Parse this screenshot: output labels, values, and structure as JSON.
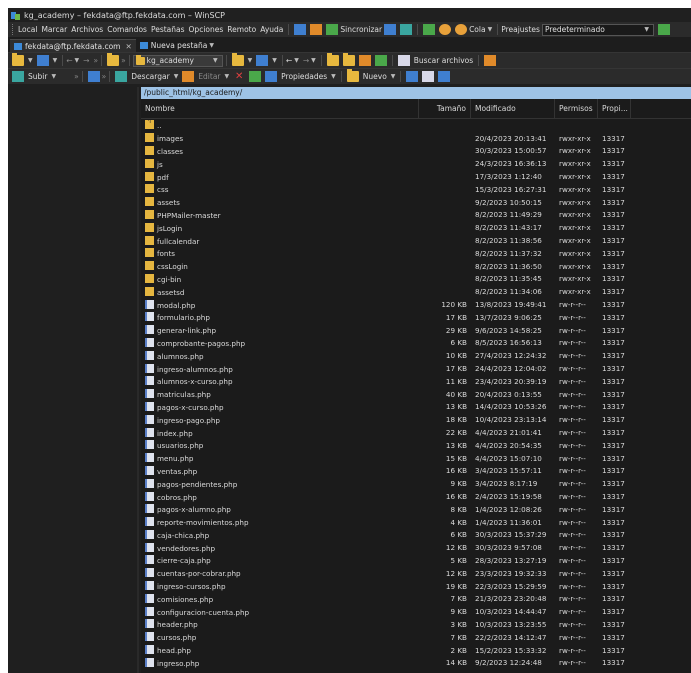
{
  "window": {
    "title": "kg_academy – fekdata@ftp.fekdata.com – WinSCP"
  },
  "menubar": {
    "items": [
      "Local",
      "Marcar",
      "Archivos",
      "Comandos",
      "Pestañas",
      "Opciones",
      "Remoto",
      "Ayuda"
    ],
    "sync_label": "Sincronizar",
    "queue_label": "Cola",
    "presets_label": "Preajustes",
    "preset_value": "Predeterminado"
  },
  "tabs": [
    {
      "label": "fekdata@ftp.fekdata.com"
    },
    {
      "label": "Nueva pestaña"
    }
  ],
  "left_toolbar": {
    "upload_label": "Subir"
  },
  "remote_toolbar": {
    "directory": "kg_academy",
    "find_label": "Buscar archivos",
    "download_label": "Descargar",
    "edit_label": "Editar",
    "properties_label": "Propiedades",
    "new_label": "Nuevo"
  },
  "remote_path": "/public_html/kg_academy/",
  "columns": {
    "name": "Nombre",
    "size": "Tamaño",
    "modified": "Modificado",
    "perms": "Permisos",
    "owner": "Propi..."
  },
  "files": [
    {
      "name": "..",
      "size": "",
      "modified": "",
      "perms": "",
      "owner": "",
      "type": "updir"
    },
    {
      "name": "images",
      "size": "",
      "modified": "20/4/2023 20:13:41",
      "perms": "rwxr-xr-x",
      "owner": "13317",
      "type": "dir"
    },
    {
      "name": "classes",
      "size": "",
      "modified": "30/3/2023 15:00:57",
      "perms": "rwxr-xr-x",
      "owner": "13317",
      "type": "dir"
    },
    {
      "name": "js",
      "size": "",
      "modified": "24/3/2023 16:36:13",
      "perms": "rwxr-xr-x",
      "owner": "13317",
      "type": "dir"
    },
    {
      "name": "pdf",
      "size": "",
      "modified": "17/3/2023 1:12:40",
      "perms": "rwxr-xr-x",
      "owner": "13317",
      "type": "dir"
    },
    {
      "name": "css",
      "size": "",
      "modified": "15/3/2023 16:27:31",
      "perms": "rwxr-xr-x",
      "owner": "13317",
      "type": "dir"
    },
    {
      "name": "assets",
      "size": "",
      "modified": "9/2/2023 10:50:15",
      "perms": "rwxr-xr-x",
      "owner": "13317",
      "type": "dir"
    },
    {
      "name": "PHPMailer-master",
      "size": "",
      "modified": "8/2/2023 11:49:29",
      "perms": "rwxr-xr-x",
      "owner": "13317",
      "type": "dir"
    },
    {
      "name": "jsLogin",
      "size": "",
      "modified": "8/2/2023 11:43:17",
      "perms": "rwxr-xr-x",
      "owner": "13317",
      "type": "dir"
    },
    {
      "name": "fullcalendar",
      "size": "",
      "modified": "8/2/2023 11:38:56",
      "perms": "rwxr-xr-x",
      "owner": "13317",
      "type": "dir"
    },
    {
      "name": "fonts",
      "size": "",
      "modified": "8/2/2023 11:37:32",
      "perms": "rwxr-xr-x",
      "owner": "13317",
      "type": "dir"
    },
    {
      "name": "cssLogin",
      "size": "",
      "modified": "8/2/2023 11:36:50",
      "perms": "rwxr-xr-x",
      "owner": "13317",
      "type": "dir"
    },
    {
      "name": "cgi-bin",
      "size": "",
      "modified": "8/2/2023 11:35:45",
      "perms": "rwxr-xr-x",
      "owner": "13317",
      "type": "dir"
    },
    {
      "name": "assetsd",
      "size": "",
      "modified": "8/2/2023 11:34:06",
      "perms": "rwxr-xr-x",
      "owner": "13317",
      "type": "dir"
    },
    {
      "name": "modal.php",
      "size": "120 KB",
      "modified": "13/8/2023 19:49:41",
      "perms": "rw-r--r--",
      "owner": "13317",
      "type": "file"
    },
    {
      "name": "formulario.php",
      "size": "17 KB",
      "modified": "13/7/2023 9:06:25",
      "perms": "rw-r--r--",
      "owner": "13317",
      "type": "file"
    },
    {
      "name": "generar-link.php",
      "size": "29 KB",
      "modified": "9/6/2023 14:58:25",
      "perms": "rw-r--r--",
      "owner": "13317",
      "type": "file"
    },
    {
      "name": "comprobante-pagos.php",
      "size": "6 KB",
      "modified": "8/5/2023 16:56:13",
      "perms": "rw-r--r--",
      "owner": "13317",
      "type": "file"
    },
    {
      "name": "alumnos.php",
      "size": "10 KB",
      "modified": "27/4/2023 12:24:32",
      "perms": "rw-r--r--",
      "owner": "13317",
      "type": "file"
    },
    {
      "name": "ingreso-alumnos.php",
      "size": "17 KB",
      "modified": "24/4/2023 12:04:02",
      "perms": "rw-r--r--",
      "owner": "13317",
      "type": "file"
    },
    {
      "name": "alumnos-x-curso.php",
      "size": "11 KB",
      "modified": "23/4/2023 20:39:19",
      "perms": "rw-r--r--",
      "owner": "13317",
      "type": "file"
    },
    {
      "name": "matriculas.php",
      "size": "40 KB",
      "modified": "20/4/2023 0:13:55",
      "perms": "rw-r--r--",
      "owner": "13317",
      "type": "file"
    },
    {
      "name": "pagos-x-curso.php",
      "size": "13 KB",
      "modified": "14/4/2023 10:53:26",
      "perms": "rw-r--r--",
      "owner": "13317",
      "type": "file"
    },
    {
      "name": "ingreso-pago.php",
      "size": "18 KB",
      "modified": "10/4/2023 23:13:14",
      "perms": "rw-r--r--",
      "owner": "13317",
      "type": "file"
    },
    {
      "name": "index.php",
      "size": "22 KB",
      "modified": "4/4/2023 21:01:41",
      "perms": "rw-r--r--",
      "owner": "13317",
      "type": "file"
    },
    {
      "name": "usuarios.php",
      "size": "13 KB",
      "modified": "4/4/2023 20:54:35",
      "perms": "rw-r--r--",
      "owner": "13317",
      "type": "file"
    },
    {
      "name": "menu.php",
      "size": "15 KB",
      "modified": "4/4/2023 15:07:10",
      "perms": "rw-r--r--",
      "owner": "13317",
      "type": "file"
    },
    {
      "name": "ventas.php",
      "size": "16 KB",
      "modified": "3/4/2023 15:57:11",
      "perms": "rw-r--r--",
      "owner": "13317",
      "type": "file"
    },
    {
      "name": "pagos-pendientes.php",
      "size": "9 KB",
      "modified": "3/4/2023 8:17:19",
      "perms": "rw-r--r--",
      "owner": "13317",
      "type": "file"
    },
    {
      "name": "cobros.php",
      "size": "16 KB",
      "modified": "2/4/2023 15:19:58",
      "perms": "rw-r--r--",
      "owner": "13317",
      "type": "file"
    },
    {
      "name": "pagos-x-alumno.php",
      "size": "8 KB",
      "modified": "1/4/2023 12:08:26",
      "perms": "rw-r--r--",
      "owner": "13317",
      "type": "file"
    },
    {
      "name": "reporte-movimientos.php",
      "size": "4 KB",
      "modified": "1/4/2023 11:36:01",
      "perms": "rw-r--r--",
      "owner": "13317",
      "type": "file"
    },
    {
      "name": "caja-chica.php",
      "size": "6 KB",
      "modified": "30/3/2023 15:37:29",
      "perms": "rw-r--r--",
      "owner": "13317",
      "type": "file"
    },
    {
      "name": "vendedores.php",
      "size": "12 KB",
      "modified": "30/3/2023 9:57:08",
      "perms": "rw-r--r--",
      "owner": "13317",
      "type": "file"
    },
    {
      "name": "cierre-caja.php",
      "size": "5 KB",
      "modified": "28/3/2023 13:27:19",
      "perms": "rw-r--r--",
      "owner": "13317",
      "type": "file"
    },
    {
      "name": "cuentas-por-cobrar.php",
      "size": "12 KB",
      "modified": "23/3/2023 19:32:33",
      "perms": "rw-r--r--",
      "owner": "13317",
      "type": "file"
    },
    {
      "name": "ingreso-cursos.php",
      "size": "19 KB",
      "modified": "22/3/2023 15:29:59",
      "perms": "rw-r--r--",
      "owner": "13317",
      "type": "file"
    },
    {
      "name": "comisiones.php",
      "size": "7 KB",
      "modified": "21/3/2023 23:20:48",
      "perms": "rw-r--r--",
      "owner": "13317",
      "type": "file"
    },
    {
      "name": "configuracion-cuenta.php",
      "size": "9 KB",
      "modified": "10/3/2023 14:44:47",
      "perms": "rw-r--r--",
      "owner": "13317",
      "type": "file"
    },
    {
      "name": "header.php",
      "size": "3 KB",
      "modified": "10/3/2023 13:23:55",
      "perms": "rw-r--r--",
      "owner": "13317",
      "type": "file"
    },
    {
      "name": "cursos.php",
      "size": "7 KB",
      "modified": "22/2/2023 14:12:47",
      "perms": "rw-r--r--",
      "owner": "13317",
      "type": "file"
    },
    {
      "name": "head.php",
      "size": "2 KB",
      "modified": "15/2/2023 15:33:32",
      "perms": "rw-r--r--",
      "owner": "13317",
      "type": "file"
    },
    {
      "name": "ingreso.php",
      "size": "14 KB",
      "modified": "9/2/2023 12:24:48",
      "perms": "rw-r--r--",
      "owner": "13317",
      "type": "file"
    }
  ]
}
